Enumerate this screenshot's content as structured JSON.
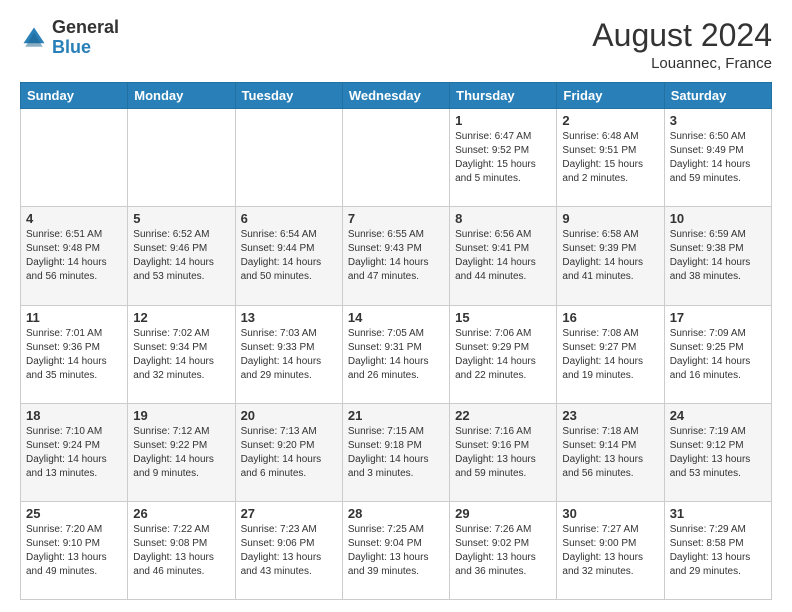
{
  "header": {
    "logo": {
      "line1": "General",
      "line2": "Blue"
    },
    "title": "August 2024",
    "location": "Louannec, France"
  },
  "weekdays": [
    "Sunday",
    "Monday",
    "Tuesday",
    "Wednesday",
    "Thursday",
    "Friday",
    "Saturday"
  ],
  "weeks": [
    [
      {
        "day": "",
        "info": ""
      },
      {
        "day": "",
        "info": ""
      },
      {
        "day": "",
        "info": ""
      },
      {
        "day": "",
        "info": ""
      },
      {
        "day": "1",
        "info": "Sunrise: 6:47 AM\nSunset: 9:52 PM\nDaylight: 15 hours\nand 5 minutes."
      },
      {
        "day": "2",
        "info": "Sunrise: 6:48 AM\nSunset: 9:51 PM\nDaylight: 15 hours\nand 2 minutes."
      },
      {
        "day": "3",
        "info": "Sunrise: 6:50 AM\nSunset: 9:49 PM\nDaylight: 14 hours\nand 59 minutes."
      }
    ],
    [
      {
        "day": "4",
        "info": "Sunrise: 6:51 AM\nSunset: 9:48 PM\nDaylight: 14 hours\nand 56 minutes."
      },
      {
        "day": "5",
        "info": "Sunrise: 6:52 AM\nSunset: 9:46 PM\nDaylight: 14 hours\nand 53 minutes."
      },
      {
        "day": "6",
        "info": "Sunrise: 6:54 AM\nSunset: 9:44 PM\nDaylight: 14 hours\nand 50 minutes."
      },
      {
        "day": "7",
        "info": "Sunrise: 6:55 AM\nSunset: 9:43 PM\nDaylight: 14 hours\nand 47 minutes."
      },
      {
        "day": "8",
        "info": "Sunrise: 6:56 AM\nSunset: 9:41 PM\nDaylight: 14 hours\nand 44 minutes."
      },
      {
        "day": "9",
        "info": "Sunrise: 6:58 AM\nSunset: 9:39 PM\nDaylight: 14 hours\nand 41 minutes."
      },
      {
        "day": "10",
        "info": "Sunrise: 6:59 AM\nSunset: 9:38 PM\nDaylight: 14 hours\nand 38 minutes."
      }
    ],
    [
      {
        "day": "11",
        "info": "Sunrise: 7:01 AM\nSunset: 9:36 PM\nDaylight: 14 hours\nand 35 minutes."
      },
      {
        "day": "12",
        "info": "Sunrise: 7:02 AM\nSunset: 9:34 PM\nDaylight: 14 hours\nand 32 minutes."
      },
      {
        "day": "13",
        "info": "Sunrise: 7:03 AM\nSunset: 9:33 PM\nDaylight: 14 hours\nand 29 minutes."
      },
      {
        "day": "14",
        "info": "Sunrise: 7:05 AM\nSunset: 9:31 PM\nDaylight: 14 hours\nand 26 minutes."
      },
      {
        "day": "15",
        "info": "Sunrise: 7:06 AM\nSunset: 9:29 PM\nDaylight: 14 hours\nand 22 minutes."
      },
      {
        "day": "16",
        "info": "Sunrise: 7:08 AM\nSunset: 9:27 PM\nDaylight: 14 hours\nand 19 minutes."
      },
      {
        "day": "17",
        "info": "Sunrise: 7:09 AM\nSunset: 9:25 PM\nDaylight: 14 hours\nand 16 minutes."
      }
    ],
    [
      {
        "day": "18",
        "info": "Sunrise: 7:10 AM\nSunset: 9:24 PM\nDaylight: 14 hours\nand 13 minutes."
      },
      {
        "day": "19",
        "info": "Sunrise: 7:12 AM\nSunset: 9:22 PM\nDaylight: 14 hours\nand 9 minutes."
      },
      {
        "day": "20",
        "info": "Sunrise: 7:13 AM\nSunset: 9:20 PM\nDaylight: 14 hours\nand 6 minutes."
      },
      {
        "day": "21",
        "info": "Sunrise: 7:15 AM\nSunset: 9:18 PM\nDaylight: 14 hours\nand 3 minutes."
      },
      {
        "day": "22",
        "info": "Sunrise: 7:16 AM\nSunset: 9:16 PM\nDaylight: 13 hours\nand 59 minutes."
      },
      {
        "day": "23",
        "info": "Sunrise: 7:18 AM\nSunset: 9:14 PM\nDaylight: 13 hours\nand 56 minutes."
      },
      {
        "day": "24",
        "info": "Sunrise: 7:19 AM\nSunset: 9:12 PM\nDaylight: 13 hours\nand 53 minutes."
      }
    ],
    [
      {
        "day": "25",
        "info": "Sunrise: 7:20 AM\nSunset: 9:10 PM\nDaylight: 13 hours\nand 49 minutes."
      },
      {
        "day": "26",
        "info": "Sunrise: 7:22 AM\nSunset: 9:08 PM\nDaylight: 13 hours\nand 46 minutes."
      },
      {
        "day": "27",
        "info": "Sunrise: 7:23 AM\nSunset: 9:06 PM\nDaylight: 13 hours\nand 43 minutes."
      },
      {
        "day": "28",
        "info": "Sunrise: 7:25 AM\nSunset: 9:04 PM\nDaylight: 13 hours\nand 39 minutes."
      },
      {
        "day": "29",
        "info": "Sunrise: 7:26 AM\nSunset: 9:02 PM\nDaylight: 13 hours\nand 36 minutes."
      },
      {
        "day": "30",
        "info": "Sunrise: 7:27 AM\nSunset: 9:00 PM\nDaylight: 13 hours\nand 32 minutes."
      },
      {
        "day": "31",
        "info": "Sunrise: 7:29 AM\nSunset: 8:58 PM\nDaylight: 13 hours\nand 29 minutes."
      }
    ]
  ]
}
